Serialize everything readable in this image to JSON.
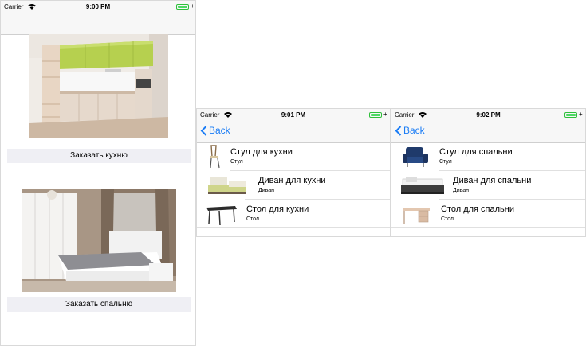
{
  "screen1": {
    "status": {
      "carrier": "Carrier",
      "time": "9:00 PM"
    },
    "kitchen_button": "Заказать кухню",
    "bedroom_button": "Заказать спальню"
  },
  "screen2": {
    "status": {
      "carrier": "Carrier",
      "time": "9:01 PM"
    },
    "back_label": "Back",
    "items": [
      {
        "title": "Стул для кухни",
        "subtitle": "Стул",
        "icon": "kitchen-chair-icon"
      },
      {
        "title": "Диван для кухни",
        "subtitle": "Диван",
        "icon": "kitchen-sofa-icon"
      },
      {
        "title": "Стол для кухни",
        "subtitle": "Стол",
        "icon": "kitchen-table-icon"
      }
    ]
  },
  "screen3": {
    "status": {
      "carrier": "Carrier",
      "time": "9:02 PM"
    },
    "back_label": "Back",
    "items": [
      {
        "title": "Стул для спальни",
        "subtitle": "Стул",
        "icon": "bedroom-armchair-icon"
      },
      {
        "title": "Диван для спальни",
        "subtitle": "Диван",
        "icon": "bedroom-sofa-bed-icon"
      },
      {
        "title": "Стол для спальни",
        "subtitle": "Стол",
        "icon": "bedroom-desk-icon"
      }
    ]
  },
  "colors": {
    "accent": "#1a7cf5",
    "battery": "#4cd964",
    "button_bg": "#efeff4",
    "navbar_bg": "#f7f7f7"
  }
}
